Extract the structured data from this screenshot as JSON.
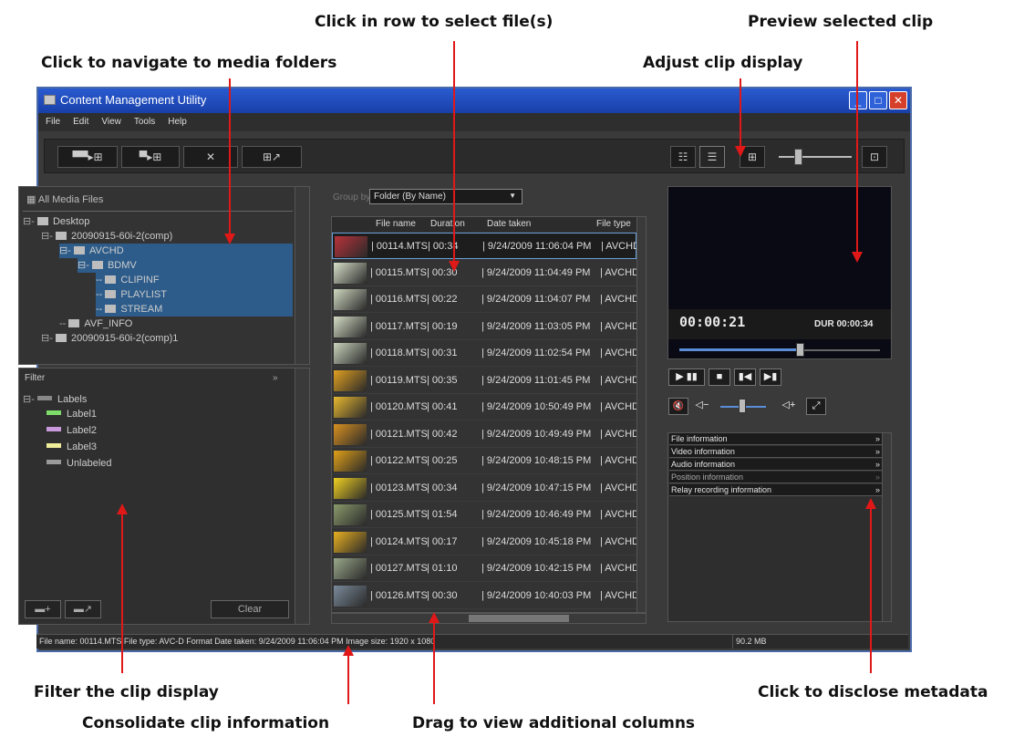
{
  "callouts": {
    "select_files": "Click in row to select file(s)",
    "preview_clip": "Preview selected clip",
    "navigate_folders": "Click to navigate to media folders",
    "adjust_display": "Adjust clip display",
    "filter_display": "Filter the clip display",
    "disclose_metadata": "Click to disclose metadata",
    "consolidate_info": "Consolidate clip information",
    "drag_columns": "Drag to view additional columns"
  },
  "window": {
    "title": "Content Management Utility",
    "controls": {
      "minimize": "_",
      "maximize": "□",
      "close": "✕"
    }
  },
  "menu": [
    "File",
    "Edit",
    "View",
    "Tools",
    "Help"
  ],
  "toolbar": {
    "import_clip": "▀▀▸⊞",
    "import_folder": "▀▸⊞",
    "delete": "✕",
    "export_clip": "⊞↗",
    "view_grid": "☷",
    "view_list": "☰",
    "view_detail": "⊞",
    "view_expand": "⊡"
  },
  "tree": {
    "header": "All Media Files",
    "items": [
      {
        "label": "Desktop"
      },
      {
        "label": "20090915-60i-2(comp)"
      },
      {
        "label": "AVCHD"
      },
      {
        "label": "BDMV"
      },
      {
        "label": "CLIPINF"
      },
      {
        "label": "PLAYLIST"
      },
      {
        "label": "STREAM"
      },
      {
        "label": "AVF_INFO"
      },
      {
        "label": "20090915-60i-2(comp)1"
      }
    ]
  },
  "filter": {
    "header": "Filter",
    "root": "Labels",
    "labels": [
      {
        "name": "Label1",
        "color": "#7ddc6a"
      },
      {
        "name": "Label2",
        "color": "#c89adc"
      },
      {
        "name": "Label3",
        "color": "#f0ee9a"
      },
      {
        "name": "Unlabeled",
        "color": "#9a9a9a"
      }
    ],
    "clear": "Clear"
  },
  "groupby": {
    "label": "Group by",
    "value": "Folder (By Name)"
  },
  "file_list": {
    "columns": [
      "File name",
      "Duration",
      "Date taken",
      "File type"
    ],
    "rows": [
      {
        "name": "00114.MTS",
        "duration": "00:34",
        "date": "9/24/2009 11:06:04 PM",
        "type": "AVCHD",
        "thumb": "#b8323a"
      },
      {
        "name": "00115.MTS",
        "duration": "00:30",
        "date": "9/24/2009 11:04:49 PM",
        "type": "AVCHD",
        "thumb": "#d7dfc8"
      },
      {
        "name": "00116.MTS",
        "duration": "00:22",
        "date": "9/24/2009 11:04:07 PM",
        "type": "AVCHD",
        "thumb": "#cfd8c0"
      },
      {
        "name": "00117.MTS",
        "duration": "00:19",
        "date": "9/24/2009 11:03:05 PM",
        "type": "AVCHD",
        "thumb": "#d4dcc4"
      },
      {
        "name": "00118.MTS",
        "duration": "00:31",
        "date": "9/24/2009 11:02:54 PM",
        "type": "AVCHD",
        "thumb": "#c9d3bc"
      },
      {
        "name": "00119.MTS",
        "duration": "00:35",
        "date": "9/24/2009 11:01:45 PM",
        "type": "AVCHD",
        "thumb": "#e0a020"
      },
      {
        "name": "00120.MTS",
        "duration": "00:41",
        "date": "9/24/2009 10:50:49 PM",
        "type": "AVCHD",
        "thumb": "#e8b830"
      },
      {
        "name": "00121.MTS",
        "duration": "00:42",
        "date": "9/24/2009 10:49:49 PM",
        "type": "AVCHD",
        "thumb": "#d89020"
      },
      {
        "name": "00122.MTS",
        "duration": "00:25",
        "date": "9/24/2009 10:48:15 PM",
        "type": "AVCHD",
        "thumb": "#e0a018"
      },
      {
        "name": "00123.MTS",
        "duration": "00:34",
        "date": "9/24/2009 10:47:15 PM",
        "type": "AVCHD",
        "thumb": "#f0d020"
      },
      {
        "name": "00125.MTS",
        "duration": "01:54",
        "date": "9/24/2009 10:46:49 PM",
        "type": "AVCHD",
        "thumb": "#8a9a6a"
      },
      {
        "name": "00124.MTS",
        "duration": "00:17",
        "date": "9/24/2009 10:45:18 PM",
        "type": "AVCHD",
        "thumb": "#e8b020"
      },
      {
        "name": "00127.MTS",
        "duration": "01:10",
        "date": "9/24/2009 10:42:15 PM",
        "type": "AVCHD",
        "thumb": "#9aa88a"
      },
      {
        "name": "00126.MTS",
        "duration": "00:30",
        "date": "9/24/2009 10:40:03 PM",
        "type": "AVCHD",
        "thumb": "#7a8a9a"
      }
    ]
  },
  "preview": {
    "time": "00:00:21",
    "duration": "DUR 00:00:34",
    "progress": 0.6
  },
  "controls": {
    "play_pause": "▶ ▮▮",
    "stop": "■",
    "prev": "▮◀",
    "next": "▶▮",
    "mute": "🔇",
    "vol_down": "◁−",
    "vol_up": "◁+",
    "fullscreen": "⤢"
  },
  "metadata": {
    "sections": [
      {
        "label": "File information",
        "enabled": true
      },
      {
        "label": "Video information",
        "enabled": true
      },
      {
        "label": "Audio information",
        "enabled": true
      },
      {
        "label": "Position information",
        "enabled": false
      },
      {
        "label": "Relay recording information",
        "enabled": true
      }
    ]
  },
  "status": {
    "text": "File name: 00114.MTS  File type: AVC-D Format  Date taken: 9/24/2009 11:06:04 PM  Image size: 1920 x 1080",
    "size": "90.2 MB"
  }
}
